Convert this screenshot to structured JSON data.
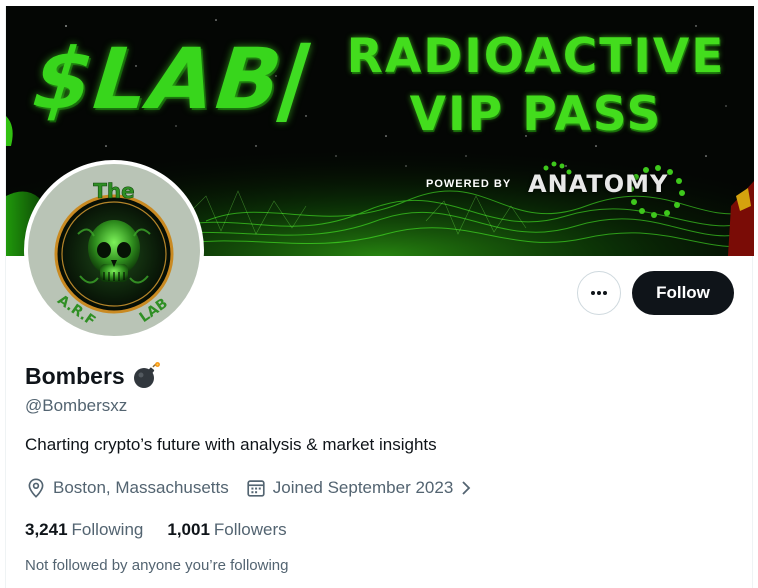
{
  "banner": {
    "left_text": "$LAB",
    "slash": "/",
    "title_line1": "RADIOACTIVE",
    "title_line2": "VIP PASS",
    "powered_by": "POWERED BY",
    "brand": "ANATOMY"
  },
  "avatar": {
    "text_top": "The",
    "text_left": "A.R.F",
    "text_right": "LAB"
  },
  "profile": {
    "display_name": "Bombers",
    "name_emoji": "bomb-icon",
    "handle": "@Bombersxz",
    "bio": "Charting crypto’s future with analysis & market insights",
    "location": "Boston, Massachusetts",
    "joined": "Joined September 2023",
    "following_count": "3,241",
    "following_label": "Following",
    "followers_count": "1,001",
    "followers_label": "Followers",
    "followed_note": "Not followed by anyone you’re following"
  },
  "actions": {
    "more_icon": "more-dots-icon",
    "follow_label": "Follow"
  },
  "colors": {
    "follow_bg": "#0f1419",
    "secondary_text": "#536471",
    "banner_green": "#43dd1d",
    "avatar_ring": "#b9c4b6"
  }
}
